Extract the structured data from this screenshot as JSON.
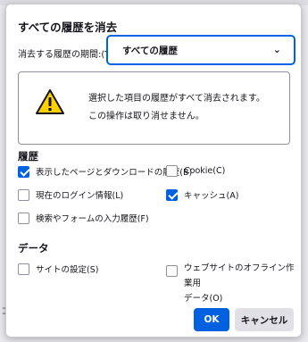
{
  "background": {
    "partial_text": "ｺ"
  },
  "dialog": {
    "title": "すべての履歴を消去",
    "range_label": "消去する履歴の期間:(T)",
    "range_value": "すべての履歴",
    "warning": {
      "line1": "選択した項目の履歴がすべて消去されます。",
      "line2": "この操作は取り消せません。"
    },
    "history_section": "履歴",
    "history_items": [
      {
        "label": "表示したページとダウンロードの履歴(B)",
        "checked": true
      },
      {
        "label": "Cookie(C)",
        "checked": false
      },
      {
        "label": "現在のログイン情報(L)",
        "checked": false
      },
      {
        "label": "キャッシュ(A)",
        "checked": true
      },
      {
        "label": "検索やフォームの入力履歴(F)",
        "checked": false
      }
    ],
    "data_section": "データ",
    "data_items": [
      {
        "label": "サイトの設定(S)",
        "checked": false
      },
      {
        "label_line1": "ウェブサイトのオフライン作業用",
        "label_line2": "データ(O)",
        "checked": false
      }
    ],
    "ok_label": "OK",
    "cancel_label": "キャンセル"
  },
  "colors": {
    "accent": "#0061e0",
    "warning_yellow": "#ffd000"
  }
}
